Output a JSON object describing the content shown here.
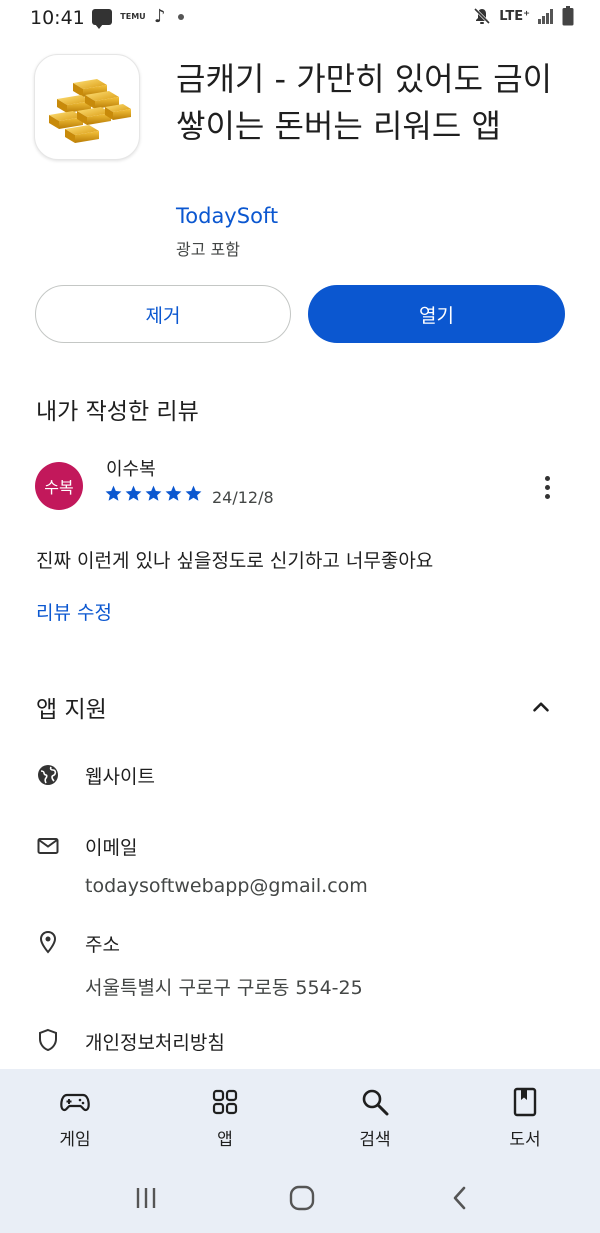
{
  "status_bar": {
    "time": "10:41",
    "lte": "LTE⁺",
    "notif_temu": "TEMU"
  },
  "app": {
    "title": "금캐기 - 가만히 있어도 금이 쌓이는 돈버는 리워드 앱",
    "developer": "TodaySoft",
    "ads_notice": "광고 포함",
    "uninstall_label": "제거",
    "open_label": "열기",
    "icon": "gold-bars-icon"
  },
  "review": {
    "heading": "내가 작성한 리뷰",
    "avatar_text": "수복",
    "reviewer": "이수복",
    "rating": 5,
    "date": "24/12/8",
    "text": "진짜 이런게 있나 싶을정도로 신기하고 너무좋아요",
    "edit_label": "리뷰 수정"
  },
  "support": {
    "heading": "앱 지원",
    "website_label": "웹사이트",
    "email_label": "이메일",
    "email_value": "todaysoftwebapp@gmail.com",
    "address_label": "주소",
    "address_value": "서울특별시 구로구 구로동 554-25",
    "privacy_label": "개인정보처리방침"
  },
  "bottom_nav": {
    "games": "게임",
    "apps": "앱",
    "search": "검색",
    "books": "도서"
  },
  "colors": {
    "accent": "#0b57d0",
    "avatar": "#c2185b",
    "nav_bg": "#e9eef6"
  }
}
